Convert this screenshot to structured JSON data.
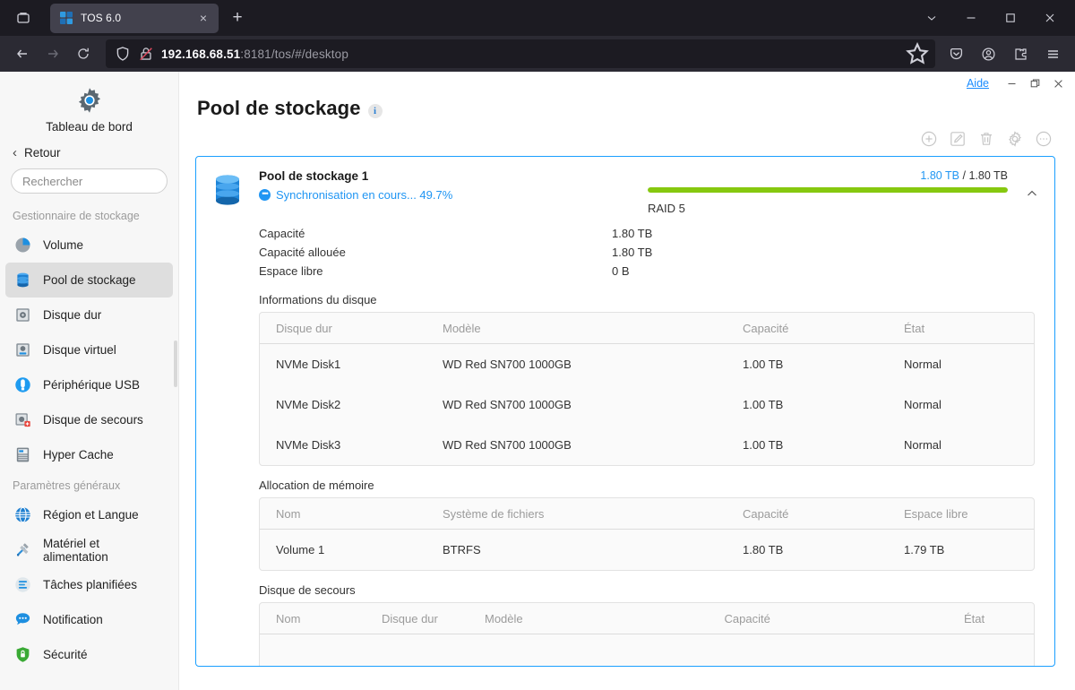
{
  "browser": {
    "tab": {
      "title": "TOS 6.0",
      "favicon": "tos-logo-icon",
      "close": "×"
    },
    "new_tab_label": "+",
    "list_all_tabs": "list-all-tabs-icon",
    "window_controls": {
      "dropdown": "chevron-down-icon",
      "minimize": "−",
      "maximize": "□",
      "close": "×"
    },
    "nav": {
      "back": "←",
      "forward": "→",
      "reload": "⟳"
    },
    "url": {
      "host": "192.168.68.51",
      "rest": ":8181/tos/#/desktop",
      "full": "192.168.68.51:8181/tos/#/desktop"
    },
    "url_icons": {
      "shield": "shield-icon",
      "lock": "lock-crossed-icon",
      "bookmark": "star-icon"
    },
    "toolbar_right": [
      "pocket-icon",
      "account-icon",
      "extensions-icon",
      "app-menu-icon"
    ]
  },
  "sidebar": {
    "dashboard": {
      "label": "Tableau de bord",
      "icon": "gear-icon"
    },
    "back": {
      "label": "Retour",
      "icon": "chevron-left-icon"
    },
    "search": {
      "placeholder": "Rechercher",
      "value": "",
      "icon": "search-icon"
    },
    "groups": [
      {
        "title": "Gestionnaire de stockage",
        "items": [
          {
            "label": "Volume",
            "icon": "pie-chart-icon",
            "active": false
          },
          {
            "label": "Pool de stockage",
            "icon": "database-icon",
            "active": true
          },
          {
            "label": "Disque dur",
            "icon": "hard-disk-icon",
            "active": false
          },
          {
            "label": "Disque virtuel",
            "icon": "virtual-disk-icon",
            "active": false
          },
          {
            "label": "Périphérique USB",
            "icon": "usb-icon",
            "active": false
          },
          {
            "label": "Disque de secours",
            "icon": "spare-disk-icon",
            "active": false
          },
          {
            "label": "Hyper Cache",
            "icon": "hyper-cache-icon",
            "active": false
          }
        ]
      },
      {
        "title": "Paramètres généraux",
        "items": [
          {
            "label": "Région et Langue",
            "icon": "globe-icon",
            "active": false
          },
          {
            "label": "Matériel et alimentation",
            "icon": "tools-icon",
            "active": false
          },
          {
            "label": "Tâches planifiées",
            "icon": "schedule-icon",
            "active": false
          },
          {
            "label": "Notification",
            "icon": "notification-icon",
            "active": false
          },
          {
            "label": "Sécurité",
            "icon": "security-shield-icon",
            "active": false
          }
        ]
      }
    ]
  },
  "app": {
    "help_link": "Aide",
    "window_controls": {
      "minimize": "−",
      "restore": "❐",
      "close": "×"
    },
    "page_title": "Pool de stockage",
    "info_badge": "i",
    "toolbar": [
      {
        "name": "add-button",
        "icon": "plus-circle-icon"
      },
      {
        "name": "edit-button",
        "icon": "pencil-square-icon"
      },
      {
        "name": "delete-button",
        "icon": "trash-icon"
      },
      {
        "name": "settings-button",
        "icon": "gear-icon"
      },
      {
        "name": "more-button",
        "icon": "ellipsis-circle-icon"
      }
    ]
  },
  "pool": {
    "icon": "database-icon",
    "name": "Pool de stockage 1",
    "status": {
      "icon": "sync-icon",
      "text": "Synchronisation en cours... 49.7%",
      "percent": 49.7
    },
    "capacity_summary": {
      "used": "1.80 TB",
      "separator": "/",
      "total": "1.80 TB"
    },
    "usage_percent": 100,
    "raid": "RAID 5",
    "collapse_icon": "chevron-up-icon",
    "details": [
      {
        "key": "Capacité",
        "value": "1.80 TB"
      },
      {
        "key": "Capacité allouée",
        "value": "1.80 TB"
      },
      {
        "key": "Espace libre",
        "value": "0 B"
      }
    ],
    "disk_section": {
      "label": "Informations du disque",
      "columns": [
        "Disque dur",
        "Modèle",
        "Capacité",
        "État"
      ],
      "rows": [
        {
          "disk": "NVMe Disk1",
          "model": "WD Red SN700 1000GB",
          "capacity": "1.00 TB",
          "state": "Normal"
        },
        {
          "disk": "NVMe Disk2",
          "model": "WD Red SN700 1000GB",
          "capacity": "1.00 TB",
          "state": "Normal"
        },
        {
          "disk": "NVMe Disk3",
          "model": "WD Red SN700 1000GB",
          "capacity": "1.00 TB",
          "state": "Normal"
        }
      ]
    },
    "memory_section": {
      "label": "Allocation de mémoire",
      "columns": [
        "Nom",
        "Système de fichiers",
        "Capacité",
        "Espace libre"
      ],
      "rows": [
        {
          "name": "Volume 1",
          "fs": "BTRFS",
          "capacity": "1.80 TB",
          "free": "1.79 TB"
        }
      ]
    },
    "spare_section": {
      "label": "Disque de secours",
      "columns": [
        "Nom",
        "Disque dur",
        "Modèle",
        "Capacité",
        "État"
      ],
      "rows": []
    }
  },
  "colors": {
    "accent_blue": "#1a9fff",
    "link_blue": "#2196f3",
    "progress_green": "#86c80f",
    "sidebar_bg": "#f7f7f7",
    "chrome_bg": "#1c1b22"
  }
}
